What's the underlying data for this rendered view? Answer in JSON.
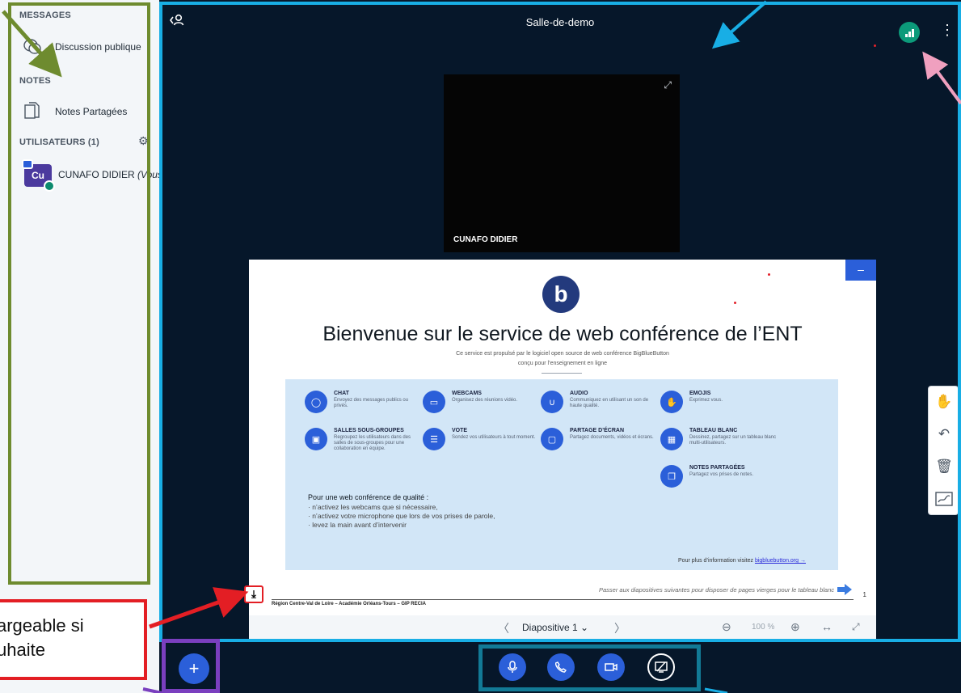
{
  "sidebar": {
    "messages_heading": "MESSAGES",
    "public_chat_label": "Discussion publique",
    "notes_heading": "NOTES",
    "shared_notes_label": "Notes Partagées",
    "users_heading": "UTILISATEURS (1)",
    "user": {
      "initials": "Cu",
      "name": "CUNAFO DIDIER",
      "you_suffix": "(Vous"
    }
  },
  "header": {
    "room_title": "Salle-de-demo"
  },
  "webcam": {
    "name": "CUNAFO DIDIER"
  },
  "slide": {
    "title": "Bienvenue sur le service de web conférence de l’ENT",
    "subtitle_1": "Ce service est propulsé par le logiciel open source de web conférence BigBlueButton",
    "subtitle_2": "conçu pour l’enseignement en ligne",
    "features": [
      {
        "title": "CHAT",
        "desc": "Envoyez des messages publics ou privés.",
        "icon": "chat-icon"
      },
      {
        "title": "WEBCAMS",
        "desc": "Organisez des réunions vidéo.",
        "icon": "webcam-icon"
      },
      {
        "title": "AUDIO",
        "desc": "Communiquez en utilisant un son de haute qualité.",
        "icon": "mic-icon"
      },
      {
        "title": "EMOJIS",
        "desc": "Exprimez vous.",
        "icon": "hand-icon"
      },
      {
        "title": "SALLES SOUS-GROUPES",
        "desc": "Regroupez les utilisateurs dans des salles de sous-groupes pour une collaboration en équipe.",
        "icon": "breakout-icon"
      },
      {
        "title": "VOTE",
        "desc": "Sondez vos utilisateurs à tout moment.",
        "icon": "poll-icon"
      },
      {
        "title": "PARTAGE D’ÉCRAN",
        "desc": "Partagez documents, vidéos et écrans.",
        "icon": "screen-icon"
      },
      {
        "title": "TABLEAU BLANC",
        "desc": "Dessinez, partagez sur un tableau blanc multi-utilisateurs.",
        "icon": "whiteboard-icon"
      },
      {
        "title": "NOTES PARTAGÉES",
        "desc": "Partagez vos prises de notes.",
        "icon": "notes-icon"
      }
    ],
    "quality_title": "Pour une web conférence de qualité :",
    "quality_items": [
      "n’activez les webcams que si nécessaire,",
      "n’activez votre microphone que lors de vos prises de parole,",
      "levez la main avant d’intervenir"
    ],
    "more_info_prefix": "Pour plus d’information visitez ",
    "more_info_link": "bigbluebutton.org →",
    "next_hint": "Passer aux diapositives suivantes pour disposer de pages vierges pour le tableau blanc",
    "page_number": "1",
    "footer": "Région Centre-Val de Loire – Académie Orléans-Tours – GIP RECIA"
  },
  "presentation_toolbar": {
    "slide_label": "Diapositive 1",
    "zoom": "100 %"
  },
  "annotation": {
    "label": "argeable si\nuhaite"
  },
  "colors": {
    "accent": "#2b5fd9",
    "background": "#06172a",
    "sidebar": "#f3f6f9",
    "connection": "#0c9a7a"
  }
}
